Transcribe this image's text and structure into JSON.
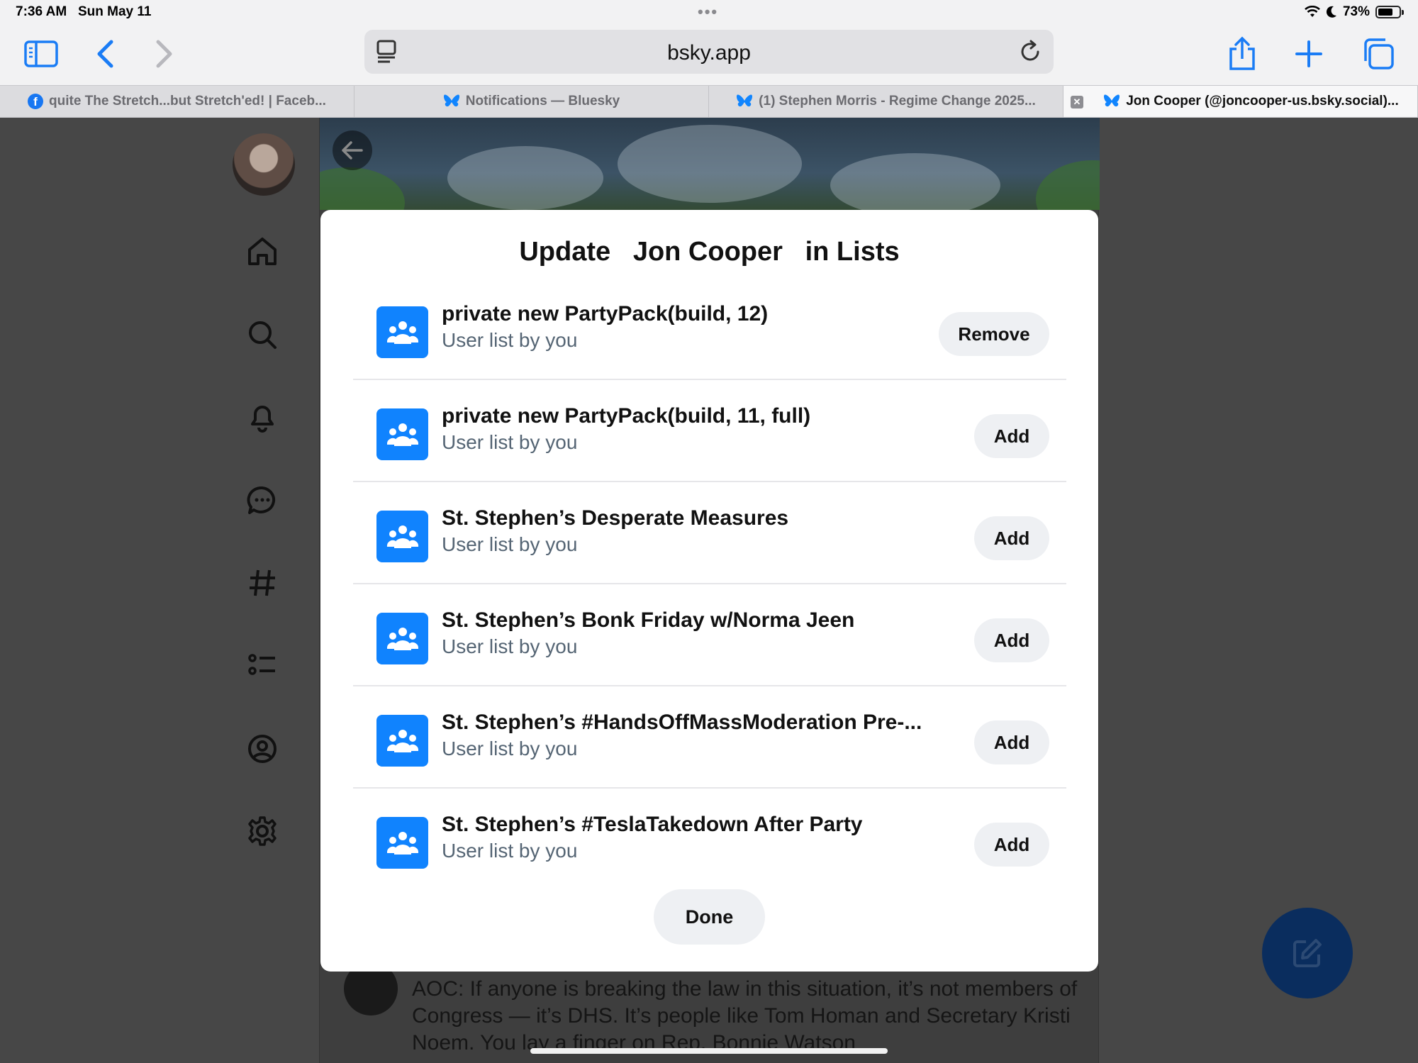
{
  "status_bar": {
    "time": "7:36 AM",
    "date": "Sun May 11",
    "battery_percent": "73%",
    "battery_level": 0.73
  },
  "browser": {
    "url": "bsky.app",
    "tabs": [
      {
        "label": "quite The Stretch...but Stretch'ed! | Faceb...",
        "icon": "facebook-icon",
        "active": false
      },
      {
        "label": "Notifications — Bluesky",
        "icon": "bluesky-butterfly-icon",
        "active": false
      },
      {
        "label": "(1) Stephen Morris - Regime Change 2025...",
        "icon": "bluesky-butterfly-icon",
        "active": false
      },
      {
        "label": "Jon Cooper (@joncooper-us.bsky.social)...",
        "icon": "bluesky-butterfly-icon",
        "active": true
      }
    ]
  },
  "modal": {
    "title": "Update   Jon Cooper   in Lists",
    "done_label": "Done",
    "lists": [
      {
        "name": "private new PartyPack(build, 12)",
        "subtitle": "User list by you",
        "action": "Remove"
      },
      {
        "name": "private new PartyPack(build, 11, full)",
        "subtitle": "User list by you",
        "action": "Add"
      },
      {
        "name": "St. Stephen’s Desperate Measures",
        "subtitle": "User list by you",
        "action": "Add"
      },
      {
        "name": "St. Stephen’s Bonk Friday w/Norma Jeen",
        "subtitle": "User list by you",
        "action": "Add"
      },
      {
        "name": "St. Stephen’s #HandsOffMassModeration Pre-...",
        "subtitle": "User list by you",
        "action": "Add"
      },
      {
        "name": "St. Stephen’s #TeslaTakedown After Party",
        "subtitle": "User list by you",
        "action": "Add"
      }
    ]
  },
  "background_post": {
    "text": "AOC: If anyone is breaking the law in this situation, it’s not members of Congress — it’s DHS. It’s people like Tom Homan and Secretary Kristi Noem. You lay a finger on Rep. Bonnie Watson"
  },
  "colors": {
    "accent_blue": "#1083fe",
    "browser_blue": "#1a7cf5",
    "overlay": "#474747"
  }
}
